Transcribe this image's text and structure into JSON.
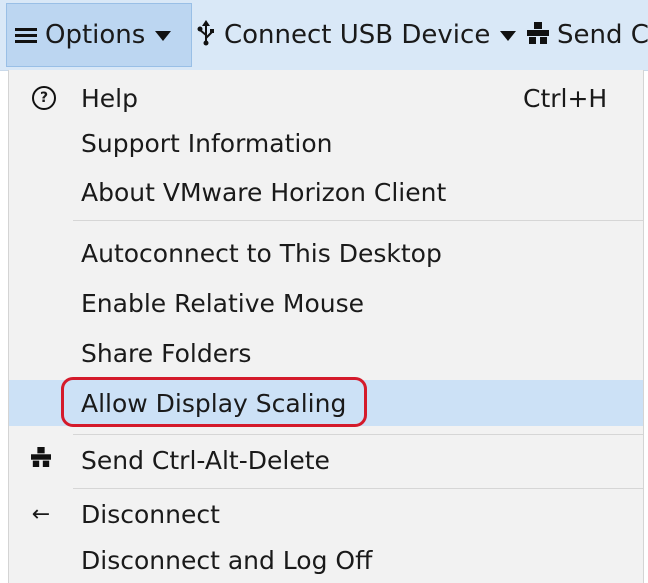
{
  "toolbar": {
    "options_label": "Options",
    "usb_label": "Connect USB Device",
    "send_label": "Send C",
    "usb_icon": "usb-icon",
    "send_icon": "ctrl-alt-del-icon"
  },
  "menu": {
    "help": {
      "label": "Help",
      "shortcut": "Ctrl+H",
      "icon": "help-circle-icon"
    },
    "support_info": {
      "label": "Support Information"
    },
    "about": {
      "label": "About VMware Horizon Client"
    },
    "autoconnect": {
      "label": "Autoconnect to This Desktop"
    },
    "relative_mouse": {
      "label": "Enable Relative Mouse"
    },
    "share_folders": {
      "label": "Share Folders"
    },
    "display_scaling": {
      "label": "Allow Display Scaling",
      "highlighted": true
    },
    "send_cad": {
      "label": "Send Ctrl-Alt-Delete",
      "icon": "ctrl-alt-del-icon"
    },
    "disconnect": {
      "label": "Disconnect",
      "icon": "arrow-left-icon"
    },
    "disconnect_logoff": {
      "label": "Disconnect and Log Off"
    }
  },
  "colors": {
    "toolbar_bg": "#d9e8f7",
    "options_active_bg": "#bcd6f1",
    "menu_bg": "#f2f2f2",
    "highlight_bg": "#cce1f6",
    "annotation_red": "#d41a2b"
  }
}
